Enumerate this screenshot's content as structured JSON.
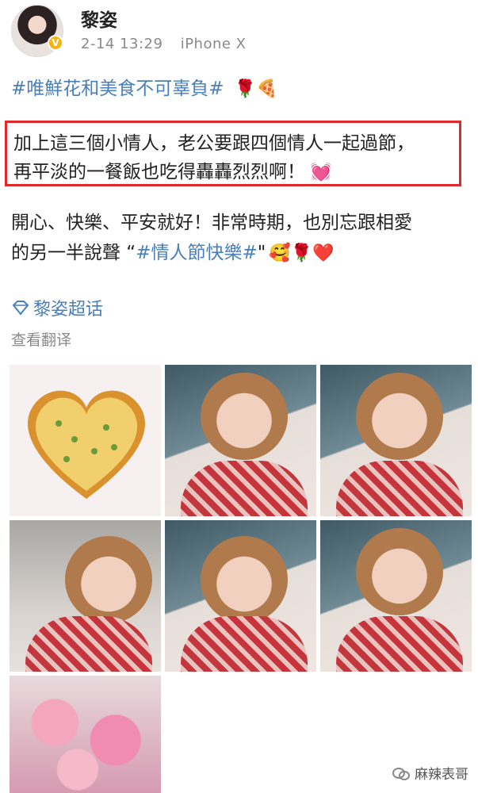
{
  "post": {
    "username": "黎姿",
    "verified_badge": "V",
    "time": "2-14 13:29",
    "device": "iPhone X",
    "topic": "#唯鮮花和美食不可辜負#",
    "topic_emojis": "🌹🍕",
    "boxed_line1": "加上這三個小情人，老公要跟四個情人一起過節，",
    "boxed_line2": "再平淡的一餐飯也吃得轟轟烈烈啊！",
    "boxed_emoji": "💓",
    "para_line1": "開心、快樂、平安就好！非常時期，也別忘跟相愛",
    "para_line2_prefix": "的另一半說聲 “",
    "para_hashtag": "#情人節快樂#",
    "para_line2_suffix": "\"",
    "para_emojis": "🥰🌹❤️",
    "supertopic": "黎姿超话",
    "translate": "查看翻译"
  },
  "images": [
    {
      "name": "pizza-heart-photo"
    },
    {
      "name": "woman-eating-photo-1"
    },
    {
      "name": "woman-eating-photo-2"
    },
    {
      "name": "woman-eating-photo-3"
    },
    {
      "name": "woman-eating-photo-4"
    },
    {
      "name": "woman-smiling-photo"
    },
    {
      "name": "flower-bouquet-photo"
    }
  ],
  "watermark": "麻辣表哥",
  "colors": {
    "link_blue": "#4a7fb8",
    "highlight_border": "#e02a2a",
    "meta_gray": "#8a8a8a",
    "verified_gold": "#f6b317"
  },
  "icons": [
    "verified-badge-icon",
    "supertopic-diamond-icon",
    "wechat-icon"
  ]
}
